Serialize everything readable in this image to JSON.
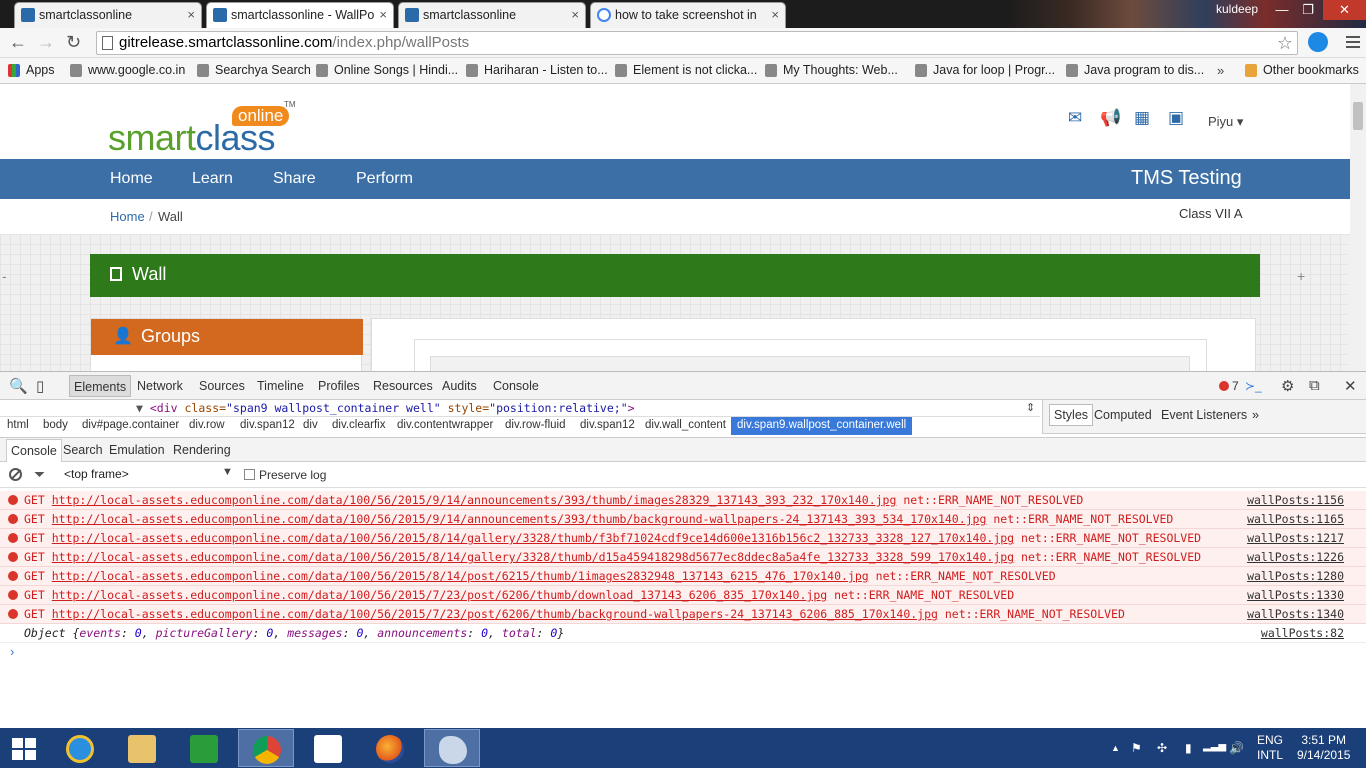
{
  "browser": {
    "tabs": [
      {
        "title": "smartclassonline",
        "close": "×"
      },
      {
        "title": "smartclassonline - WallPo",
        "close": "×"
      },
      {
        "title": "smartclassonline",
        "close": "×"
      },
      {
        "title": "how to take screenshot in",
        "close": "×"
      }
    ],
    "window_user": "kuldeep",
    "window_buttons": {
      "minimize": "—",
      "restore": "❐",
      "close": "✕"
    },
    "nav_icons": {
      "back": "←",
      "forward": "→",
      "reload": "↻"
    },
    "url_host": "gitrelease.smartclassonline.com",
    "url_path": "/index.php/wallPosts",
    "star": "☆",
    "bookmarks": [
      {
        "label": "Apps",
        "type": "apps"
      },
      {
        "label": "www.google.co.in",
        "type": "page"
      },
      {
        "label": "Searchya Search",
        "type": "page"
      },
      {
        "label": "Online Songs | Hindi...",
        "type": "page"
      },
      {
        "label": "Hariharan - Listen to...",
        "type": "page"
      },
      {
        "label": "Element is not clicka...",
        "type": "page"
      },
      {
        "label": "My Thoughts: Web...",
        "type": "page"
      },
      {
        "label": "Java for loop | Progr...",
        "type": "page"
      },
      {
        "label": "Java program to dis...",
        "type": "page"
      }
    ],
    "bookmarks_more": "»",
    "other_bookmarks": "Other bookmarks"
  },
  "site": {
    "logo": {
      "online": "online",
      "smart": "smart",
      "class": "class",
      "tm": "TM"
    },
    "header_icons": [
      {
        "name": "mail-icon",
        "glyph": "✉"
      },
      {
        "name": "megaphone-icon",
        "glyph": "📢"
      },
      {
        "name": "calendar-icon",
        "glyph": "▦"
      },
      {
        "name": "picture-icon",
        "glyph": "▣"
      }
    ],
    "user_menu": "Piyu ▾",
    "nav": [
      "Home",
      "Learn",
      "Share",
      "Perform"
    ],
    "brand_right": "TMS Testing",
    "breadcrumb": {
      "home": "Home",
      "sep": "/",
      "current": "Wall"
    },
    "class_label": "Class VII A",
    "wall_title": "Wall",
    "groups_title": "Groups",
    "edge_left": "-",
    "edge_right": "+"
  },
  "devtools": {
    "tabs": [
      "Elements",
      "Network",
      "Sources",
      "Timeline",
      "Profiles",
      "Resources",
      "Audits",
      "Console"
    ],
    "active_tab": "Elements",
    "error_count": "7",
    "icons": {
      "search": "🔍",
      "device": "▯",
      "console_toggle": "≻_",
      "settings": "⚙",
      "dock": "⧉",
      "close": "✕"
    },
    "dom_line": {
      "arrow": "▼",
      "open": "<div ",
      "class_attr": "class=",
      "class_val": "\"span9 wallpost_container  well\"",
      "style_attr": " style=",
      "style_val": "\"position:relative;\"",
      "close": ">"
    },
    "breadcrumbs": [
      "html",
      "body",
      "div#page.container",
      "div.row",
      "div.span12",
      "div",
      "div.clearfix",
      "div.contentwrapper",
      "div.row-fluid",
      "div.span12",
      "div.wall_content",
      "div.span9.wallpost_container.well"
    ],
    "styles_tabs": [
      "Styles",
      "Computed",
      "Event Listeners"
    ],
    "styles_more": "»",
    "drawer_tabs": [
      "Console",
      "Search",
      "Emulation",
      "Rendering"
    ],
    "frame_select": "<top frame>",
    "frame_arrow": "▼",
    "preserve_log": "Preserve log",
    "errors": [
      {
        "method": "GET",
        "url": "http://local-assets.educomponline.com/data/100/56/2015/9/14/announcements/393/thumb/images28329_137143_393_232_170x140.jpg",
        "err": "net::ERR_NAME_NOT_RESOLVED",
        "src": "wallPosts:1156"
      },
      {
        "method": "GET",
        "url": "http://local-assets.educomponline.com/data/100/56/2015/9/14/announcements/393/thumb/background-wallpapers-24_137143_393_534_170x140.jpg",
        "err": "net::ERR_NAME_NOT_RESOLVED",
        "src": "wallPosts:1165"
      },
      {
        "method": "GET",
        "url": "http://local-assets.educomponline.com/data/100/56/2015/8/14/gallery/3328/thumb/f3bf71024cdf9ce14d600e1316b156c2_132733_3328_127_170x140.jpg",
        "err": "net::ERR_NAME_NOT_RESOLVED",
        "src": "wallPosts:1217"
      },
      {
        "method": "GET",
        "url": "http://local-assets.educomponline.com/data/100/56/2015/8/14/gallery/3328/thumb/d15a459418298d5677ec8ddec8a5a4fe_132733_3328_599_170x140.jpg",
        "err": "net::ERR_NAME_NOT_RESOLVED",
        "src": "wallPosts:1226"
      },
      {
        "method": "GET",
        "url": "http://local-assets.educomponline.com/data/100/56/2015/8/14/post/6215/thumb/1images2832948_137143_6215_476_170x140.jpg",
        "err": "net::ERR_NAME_NOT_RESOLVED",
        "src": "wallPosts:1280"
      },
      {
        "method": "GET",
        "url": "http://local-assets.educomponline.com/data/100/56/2015/7/23/post/6206/thumb/download_137143_6206_835_170x140.jpg",
        "err": "net::ERR_NAME_NOT_RESOLVED",
        "src": "wallPosts:1330"
      },
      {
        "method": "GET",
        "url": "http://local-assets.educomponline.com/data/100/56/2015/7/23/post/6206/thumb/background-wallpapers-24_137143_6206_885_170x140.jpg",
        "err": "net::ERR_NAME_NOT_RESOLVED",
        "src": "wallPosts:1340"
      }
    ],
    "object_log": {
      "prefix": "Object {",
      "pairs": [
        [
          "events",
          "0"
        ],
        [
          "pictureGallery",
          "0"
        ],
        [
          "messages",
          "0"
        ],
        [
          "announcements",
          "0"
        ],
        [
          "total",
          "0"
        ]
      ],
      "suffix": "}",
      "src": "wallPosts:82"
    },
    "prompt": "›"
  },
  "taskbar": {
    "tray_icons": [
      "▲",
      "⚑",
      "✣",
      "▮",
      "▂▃▅",
      "🔊"
    ],
    "lang": {
      "line1": "ENG",
      "line2": "INTL"
    },
    "time": "3:51 PM",
    "date": "9/14/2015"
  },
  "colors": {
    "nav_blue": "#3b6fa6",
    "wall_green": "#2e7a1b",
    "groups_orange": "#d2691e",
    "logo_green": "#5aa02c",
    "logo_blue": "#2c6aa8",
    "error_red": "#d01d1d",
    "taskbar": "#1b3f78"
  }
}
